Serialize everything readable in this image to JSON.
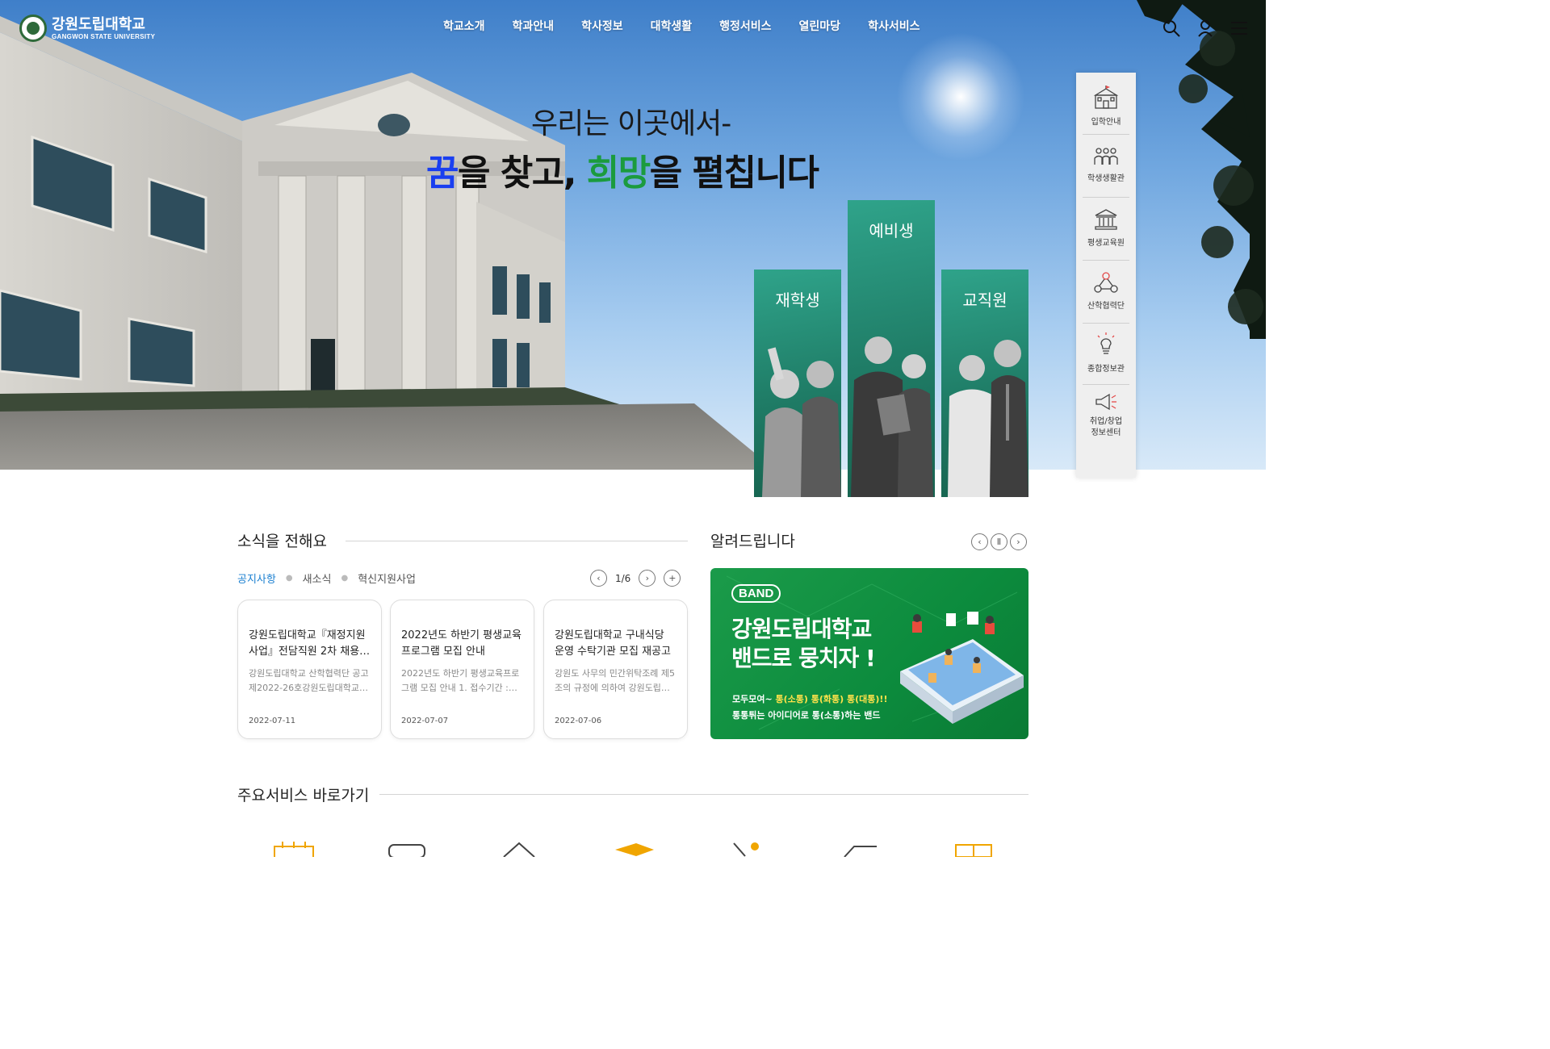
{
  "header": {
    "logo_ko": "강원도립대학교",
    "logo_en": "GANGWON STATE UNIVERSITY",
    "nav": [
      "학교소개",
      "학과안내",
      "학사정보",
      "대학생활",
      "행정서비스",
      "열린마당",
      "학사서비스"
    ],
    "icons": [
      "search-icon",
      "user-icon",
      "menu-icon"
    ]
  },
  "hero": {
    "slogan_line1": "우리는 이곳에서-",
    "slogan_k1": "꿈",
    "slogan_p1": "을 찾고, ",
    "slogan_k2": "희망",
    "slogan_p2": "을 펼칩니다",
    "personas": [
      "재학생",
      "예비생",
      "교직원"
    ],
    "colors": {
      "kkum": "#1a3ff0",
      "huimang": "#1b9b3e",
      "persona": "#23866f"
    }
  },
  "quick_menu": [
    {
      "label": "입학안내",
      "icon": "school-building-icon"
    },
    {
      "label": "학생생활관",
      "icon": "dormitory-icon"
    },
    {
      "label": "평생교육원",
      "icon": "institution-icon"
    },
    {
      "label": "산학협력단",
      "icon": "network-icon"
    },
    {
      "label": "종합정보관",
      "icon": "lightbulb-icon"
    },
    {
      "label": "취업/창업\n정보센터",
      "label1": "취업/창업",
      "label2": "정보센터",
      "icon": "megaphone-icon"
    }
  ],
  "news": {
    "title": "소식을 전해요",
    "tabs": [
      "공지사항",
      "새소식",
      "혁신지원사업"
    ],
    "page": "1/6",
    "cards": [
      {
        "title": "강원도립대학교『재정지원사업』전담직원 2차 채용…",
        "body": "강원도립대학교 산학협력단 공고 제2022-26호강원도립대학교…",
        "date": "2022-07-11"
      },
      {
        "title": "2022년도 하반기 평생교육 프로그램 모집 안내",
        "body": "2022년도 하반기 평생교육프로그램 모집 안내 1. 접수기간 :…",
        "date": "2022-07-07"
      },
      {
        "title": "강원도립대학교 구내식당 운영 수탁기관 모집 재공고(…",
        "body": "강원도 사무의 민간위탁조례 제5조의 규정에 의하여 강원도립…",
        "date": "2022-07-06"
      }
    ]
  },
  "notice": {
    "title": "알려드립니다",
    "banner": {
      "badge": "BAND",
      "headline1": "강원도립대학교",
      "headline2": "밴드로 뭉치자 !",
      "sub1_a": "모두모여~ ",
      "sub1_b": "통(소통) 통(화통) 통(대통)!!",
      "sub2": "통통튀는 아이디어로 통(소통)하는 밴드",
      "bg": "#129645"
    }
  },
  "services": {
    "title": "주요서비스 바로가기"
  }
}
